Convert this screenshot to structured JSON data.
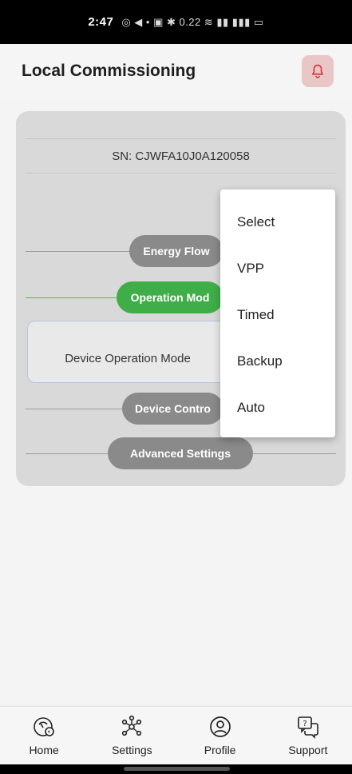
{
  "status_bar": {
    "time": "2:47",
    "icons_text": "◎ ◀ • ▣ ✱ 0.22 ≋ ▮▮ ▮▮▮ ▭"
  },
  "header": {
    "title": "Local Commissioning",
    "accent_color": "#e9c7c7",
    "bell_icon": "bell-icon"
  },
  "card": {
    "serial_number": "SN: CJWFA10J0A120058",
    "sections": [
      {
        "label": "Energy Flow",
        "active": false
      },
      {
        "label": "Operation Mod",
        "active": true
      },
      {
        "label": "Device Contro",
        "active": false
      },
      {
        "label": "Advanced Settings",
        "active": false
      }
    ],
    "device_operation_mode_label": "Device Operation Mode",
    "active_color": "#3fae49",
    "inactive_color": "#8a8a8a"
  },
  "dropdown": {
    "options": [
      "Select",
      "VPP",
      "Timed",
      "Backup",
      "Auto"
    ]
  },
  "bottom_nav": {
    "items": [
      {
        "label": "Home",
        "icon": "speedometer-icon"
      },
      {
        "label": "Settings",
        "icon": "network-icon"
      },
      {
        "label": "Profile",
        "icon": "user-circle-icon"
      },
      {
        "label": "Support",
        "icon": "help-chat-icon"
      }
    ]
  }
}
